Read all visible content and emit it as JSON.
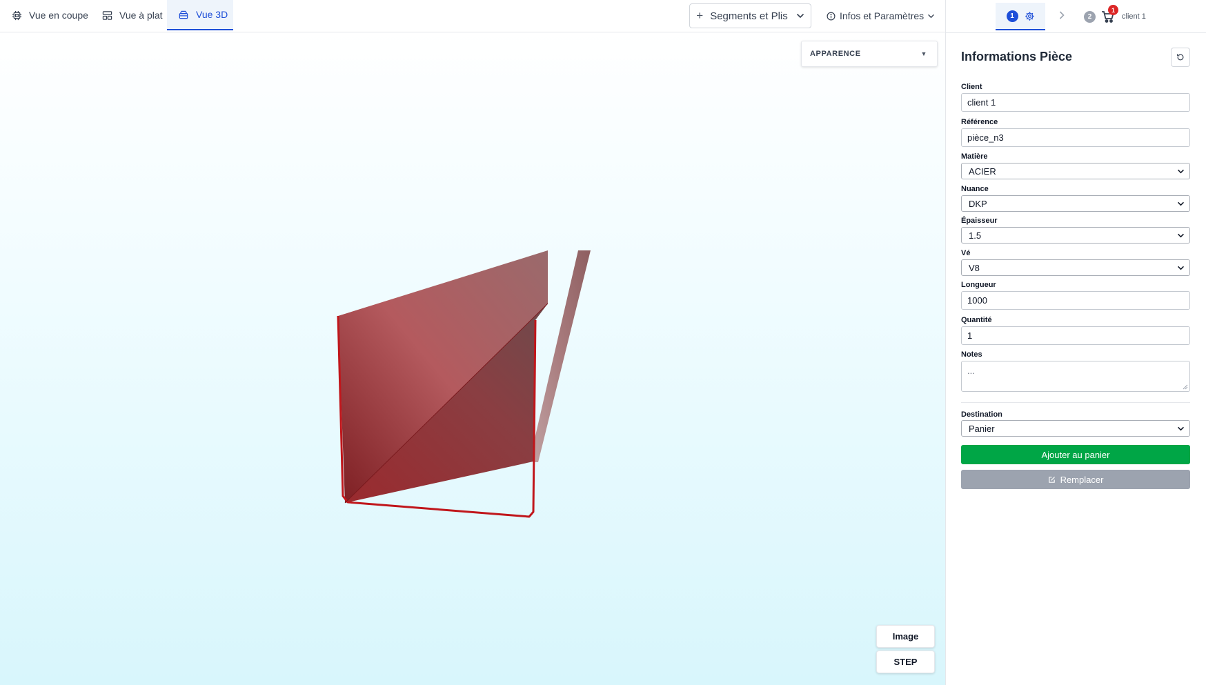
{
  "topbar": {
    "tabs": [
      {
        "label": "Vue en coupe",
        "icon": "cpu-icon"
      },
      {
        "label": "Vue à plat",
        "icon": "layout-icon"
      },
      {
        "label": "Vue 3D",
        "icon": "box-3d-icon",
        "active": true
      }
    ],
    "segments_label": "Segments et Plis",
    "infos_label": "Infos et Paramètres"
  },
  "viewport": {
    "appearance_label": "APPARENCE",
    "export_image_label": "Image",
    "export_step_label": "STEP",
    "model_color": "#a8383c"
  },
  "steps": {
    "step1_number": "1",
    "step2_number": "2",
    "cart_count": "1",
    "client_label": "client 1"
  },
  "form": {
    "title": "Informations Pièce",
    "client_label": "Client",
    "client_value": "client 1",
    "reference_label": "Référence",
    "reference_value": "pièce_n3",
    "matiere_label": "Matière",
    "matiere_value": "ACIER",
    "nuance_label": "Nuance",
    "nuance_value": "DKP",
    "epaisseur_label": "Épaisseur",
    "epaisseur_value": "1.5",
    "ve_label": "Vé",
    "ve_value": "V8",
    "longueur_label": "Longueur",
    "longueur_value": "1000",
    "quantite_label": "Quantité",
    "quantite_value": "1",
    "notes_label": "Notes",
    "notes_value": "...",
    "destination_label": "Destination",
    "destination_value": "Panier",
    "add_button": "Ajouter au panier",
    "replace_button": "Remplacer"
  },
  "colors": {
    "primary": "#1d4ed8",
    "success": "#00a646",
    "disabled": "#9ca3af",
    "badge": "#dc2626"
  }
}
